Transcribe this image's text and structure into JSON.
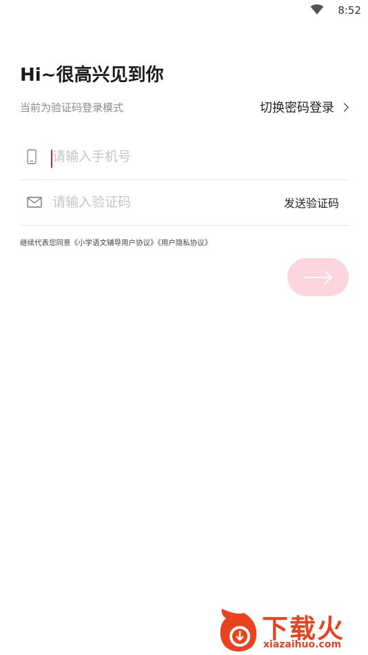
{
  "status_bar": {
    "time": "8:52",
    "icon": "wifi-icon"
  },
  "header": {
    "title": "Hi~很高兴见到你",
    "subtitle": "当前为验证码登录模式",
    "switch_label": "切换密码登录"
  },
  "form": {
    "phone": {
      "placeholder": "请输入手机号",
      "value": "",
      "icon": "phone-icon"
    },
    "code": {
      "placeholder": "请输入验证码",
      "value": "",
      "icon": "mail-icon",
      "send_label": "发送验证码"
    }
  },
  "agreement": {
    "prefix": "继续代表您同意",
    "user_agreement": "《小学语文辅导用户协议》",
    "privacy_policy": "《用户隐私协议》"
  },
  "submit": {
    "icon": "arrow-right-icon",
    "color": "#fcd6df"
  },
  "watermark": {
    "text": "下载火",
    "domain": "xiazaihuo.com",
    "color": "#e8431e"
  },
  "colors": {
    "caret": "#c2185b",
    "divider": "#e3e3e3"
  }
}
